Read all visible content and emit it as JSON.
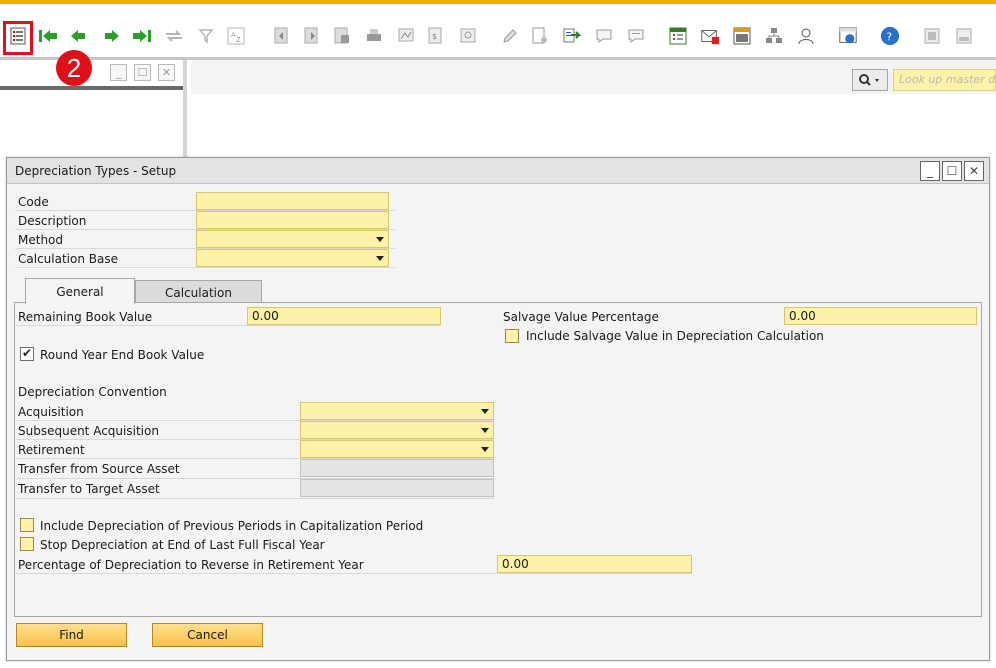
{
  "toolbar": {
    "icons": [
      "form-settings-icon",
      "first-record-icon",
      "previous-record-icon",
      "next-record-icon",
      "last-record-icon",
      "refresh-icon",
      "filter-icon",
      "sort-icon",
      "base-document-icon",
      "target-document-icon",
      "layout-icon",
      "print-icon",
      "preview-icon",
      "export-icon",
      "lock-icon",
      "pencil-icon",
      "document-settings-icon",
      "data-transfer-icon",
      "message-icon",
      "chat-icon",
      "calendar-icon",
      "mail-icon",
      "calculator-icon",
      "org-chart-icon",
      "user-icon",
      "browser-icon",
      "help-icon",
      "sap-icon-1",
      "sap-icon-2"
    ],
    "badge": "2"
  },
  "lookup": {
    "placeholder": "Look up master data"
  },
  "dialog": {
    "title": "Depreciation Types - Setup",
    "header": {
      "code_label": "Code",
      "description_label": "Description",
      "method_label": "Method",
      "calc_base_label": "Calculation Base",
      "code_value": "",
      "description_value": "",
      "method_value": "",
      "calc_base_value": ""
    },
    "tabs": [
      {
        "label": "General",
        "active": true
      },
      {
        "label": "Calculation",
        "active": false
      }
    ],
    "general": {
      "remaining_book_value_label": "Remaining Book Value",
      "remaining_book_value": "0.00",
      "salvage_pct_label": "Salvage Value Percentage",
      "salvage_pct": "0.00",
      "include_salvage_label": "Include Salvage Value in Depreciation Calculation",
      "include_salvage_checked": false,
      "round_label": "Round Year End Book Value",
      "round_checked": true,
      "convention_heading": "Depreciation Convention",
      "acquisition_label": "Acquisition",
      "subsequent_acq_label": "Subsequent Acquisition",
      "retirement_label": "Retirement",
      "transfer_from_label": "Transfer from Source Asset",
      "transfer_to_label": "Transfer to Target Asset",
      "include_prev_label": "Include Depreciation of Previous Periods in Capitalization Period",
      "include_prev_checked": false,
      "stop_label": "Stop Depreciation at End of Last Full Fiscal Year",
      "stop_checked": false,
      "pct_reverse_label": "Percentage of Depreciation to Reverse in Retirement Year",
      "pct_reverse": "0.00"
    },
    "buttons": {
      "find": "Find",
      "cancel": "Cancel"
    }
  }
}
